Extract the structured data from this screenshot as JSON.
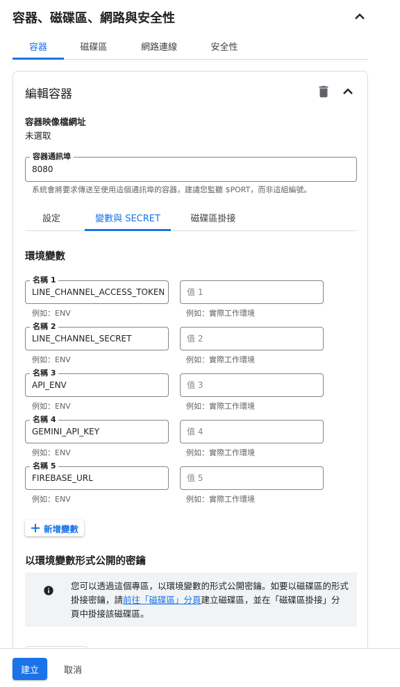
{
  "header": {
    "title": "容器、磁碟區、網路與安全性"
  },
  "tabs": [
    {
      "label": "容器",
      "active": true
    },
    {
      "label": "磁碟區",
      "active": false
    },
    {
      "label": "網路連線",
      "active": false
    },
    {
      "label": "安全性",
      "active": false
    }
  ],
  "editor": {
    "title": "編輯容器",
    "image_url_label": "容器映像檔網址",
    "image_url_value": "未選取",
    "port_label": "容器通訊埠",
    "port_value": "8080",
    "port_hint": "系統會將要求傳送至使用這個通訊埠的容器，建議您監聽 $PORT，而非這組編號。"
  },
  "sub_tabs": [
    {
      "label": "設定",
      "active": false
    },
    {
      "label": "變數與 SECRET",
      "active": true
    },
    {
      "label": "磁碟區掛接",
      "active": false
    }
  ],
  "env": {
    "title": "環境變數",
    "name_hint": "例如：ENV",
    "value_hint": "例如：實際工作環境",
    "vars": [
      {
        "name_label": "名稱 1",
        "name_value": "LINE_CHANNEL_ACCESS_TOKEN",
        "value_placeholder": "值 1"
      },
      {
        "name_label": "名稱 2",
        "name_value": "LINE_CHANNEL_SECRET",
        "value_placeholder": "值 2"
      },
      {
        "name_label": "名稱 3",
        "name_value": "API_ENV",
        "value_placeholder": "值 3"
      },
      {
        "name_label": "名稱 4",
        "name_value": "GEMINI_API_KEY",
        "value_placeholder": "值 4"
      },
      {
        "name_label": "名稱 5",
        "name_value": "FIREBASE_URL",
        "value_placeholder": "值 5"
      }
    ],
    "add_label": "新增變數"
  },
  "secrets": {
    "title": "以環境變數形式公開的密鑰",
    "info_before": "您可以透過這個專區，以環境變數的形式公開密鑰。如要以磁碟區的形式掛接密鑰，請",
    "info_link": "前往「磁碟區」分頁",
    "info_after": "建立磁碟區，並在「磁碟區掛接」分頁中掛接該磁碟區。"
  },
  "footer": {
    "create_label": "建立",
    "cancel_label": "取消"
  },
  "colors": {
    "accent": "#1a73e8",
    "text": "#202124",
    "muted": "#5f6368",
    "border": "#dadce0"
  }
}
